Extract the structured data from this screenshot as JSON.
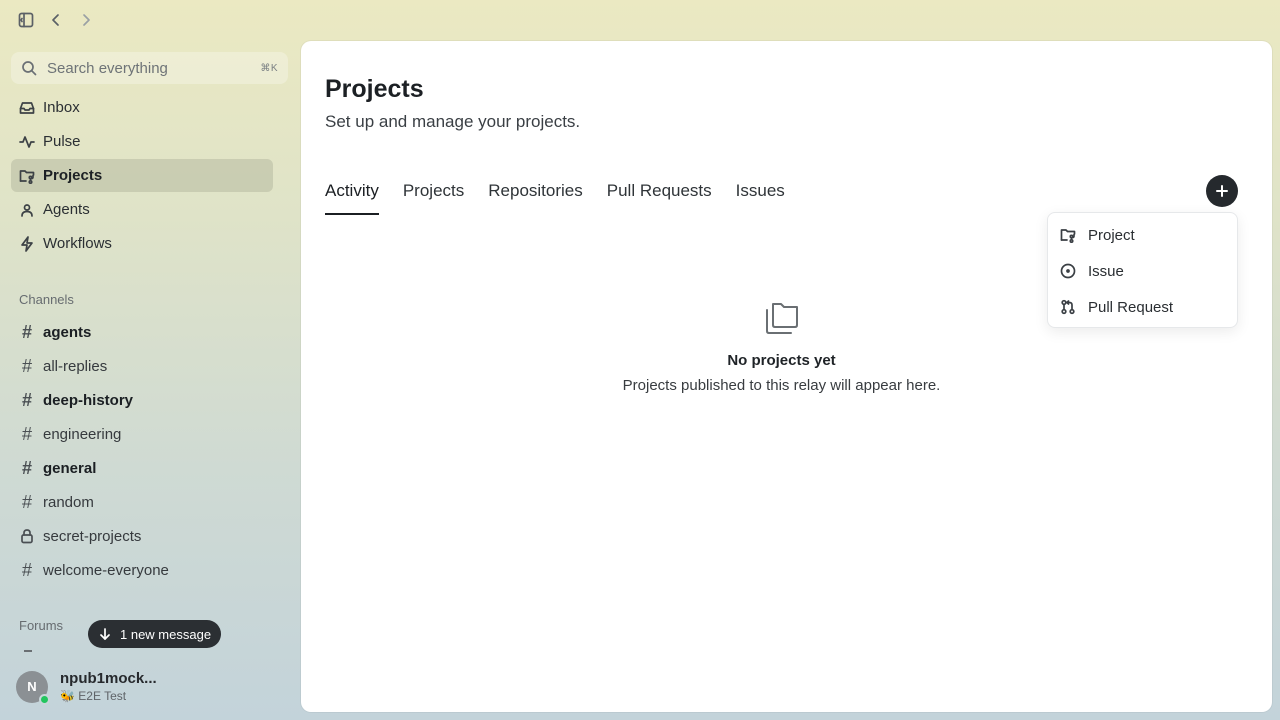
{
  "search": {
    "placeholder": "Search everything",
    "shortcut": "⌘K"
  },
  "nav": [
    {
      "label": "Inbox",
      "icon": "inbox-icon"
    },
    {
      "label": "Pulse",
      "icon": "pulse-icon"
    },
    {
      "label": "Projects",
      "icon": "folder-git-icon",
      "active": true
    },
    {
      "label": "Agents",
      "icon": "agents-icon"
    },
    {
      "label": "Workflows",
      "icon": "bolt-icon"
    }
  ],
  "channels_label": "Channels",
  "channels": [
    {
      "name": "agents",
      "unread": true
    },
    {
      "name": "all-replies"
    },
    {
      "name": "deep-history",
      "unread": true
    },
    {
      "name": "engineering"
    },
    {
      "name": "general",
      "unread": true
    },
    {
      "name": "random"
    },
    {
      "name": "secret-projects",
      "private": true
    },
    {
      "name": "welcome-everyone"
    }
  ],
  "forums_label": "Forums",
  "new_message_pill": "1 new message",
  "user": {
    "initial": "N",
    "name": "npub1mock...",
    "status_emoji": "🐝",
    "status": "E2E Test"
  },
  "page": {
    "title": "Projects",
    "subtitle": "Set up and manage your projects."
  },
  "tabs": [
    "Activity",
    "Projects",
    "Repositories",
    "Pull Requests",
    "Issues"
  ],
  "create_menu": [
    "Project",
    "Issue",
    "Pull Request"
  ],
  "empty_state": {
    "title": "No projects yet",
    "message": "Projects published to this relay will appear here."
  }
}
